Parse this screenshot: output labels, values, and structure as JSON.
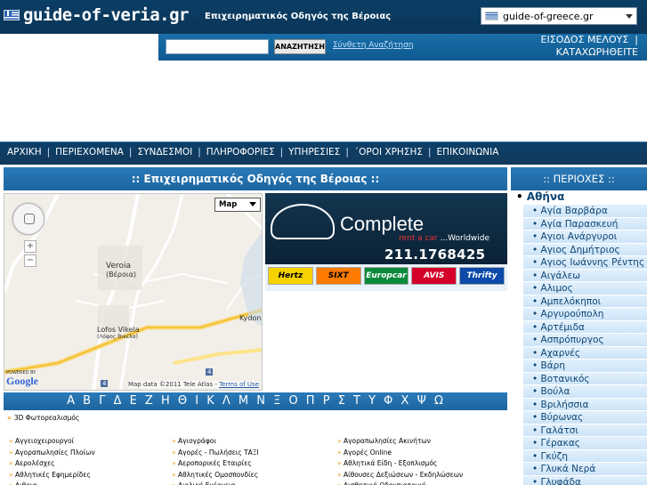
{
  "header": {
    "logo_text": "guide-of-veria.gr",
    "tagline": "Επιχειρηματικός Οδηγός της Βέροιας",
    "site_select": "guide-of-greece.gr"
  },
  "search": {
    "button_label": "ΑΝΑΖΗΤΗΣΗ",
    "advanced_link": "Σύνθετη Αναζήτηση",
    "login": "ΕΙΣΟΔΟΣ ΜΕΛΟΥΣ",
    "login_sep": "|",
    "register": "ΚΑΤΑΧΩΡΗΘΕΙΤΕ"
  },
  "nav": {
    "items": [
      "ΑΡΧΙΚΗ",
      "ΠΕΡΙΕΧΟΜΕΝΑ",
      "ΣΥΝΔΕΣΜΟΙ",
      "ΠΛΗΡΟΦΟΡΙΕΣ",
      "ΥΠΗΡΕΣΙΕΣ",
      "΄ΟΡΟΙ ΧΡΗΣΗΣ",
      "ΕΠΙΚΟΙΝΩΝΙΑ"
    ],
    "separator": "|"
  },
  "main": {
    "heading": ":: Επιχειρηματικός Οδηγός της Βέροιας ::"
  },
  "map": {
    "type_label": "Map",
    "zoom_in": "+",
    "zoom_out": "−",
    "label_veroia": "Veroia",
    "label_veroia_gr": "(Βέροια)",
    "label_lofos": "Lofos Vikela",
    "label_lofos_gr": "(Λόφος Βικέλα)",
    "label_kydon": "Kydon",
    "google_logo": "Google",
    "powered_by": "POWERED BY",
    "copyright": "Map data ©2011 Tele Atlas - ",
    "terms": "Terms of Use",
    "road_4": "4",
    "road_4b": "4"
  },
  "ad": {
    "brand": "Complete",
    "sub_red": "rent a car",
    "sub_white": "...Worldwide",
    "phone": "211.1768425",
    "logos": [
      "Hertz",
      "SIXT",
      "Europcar",
      "AVIS",
      "Thrifty"
    ]
  },
  "alphabet": "Α Β Γ Δ Ε Ζ Η Θ Ι Κ Λ Μ Ν Ξ Ο Π Ρ Σ Τ Υ Φ Χ Ψ Ω",
  "categories": {
    "first": "3D Φωτορεαλισμός",
    "col1": [
      "Αγγειοχειρουργοί",
      "Αγοραπωλησίες Πλοίων",
      "Αερολέσχες",
      "Αθλητικές Εφημερίδες",
      "Αιθρια"
    ],
    "col2": [
      "Αγιογράφοι",
      "Αγορές - Πωλήσεις ΤΑΞΙ",
      "Αεροπορικές Εταιρίες",
      "Αθλητικές Ομοσπονδίες",
      "Αιολική Ενέργεια"
    ],
    "col3": [
      "Αγοραπωλησίες Ακινήτων",
      "Αγορές Online",
      "Αθλητικά Είδη - Εξοπλισμός",
      "Αίθουσες Δεξιώσεων - Εκδηλώσεων",
      "Αισθητική Οδοντιατρική"
    ]
  },
  "sidebar": {
    "heading": ":: ΠΕΡΙΟΧΕΣ ::",
    "parent": "Αθήνα",
    "items": [
      "Αγία Βαρβάρα",
      "Αγία Παρασκευή",
      "Αγιοι Ανάργυροι",
      "Αγιος Δημήτριος",
      "Αγιος Ιωάννης Ρέντης",
      "Αιγάλεω",
      "Αλιμος",
      "Αμπελόκηποι",
      "Αργυρούπολη",
      "Αρτέμιδα",
      "Ασπρόπυργος",
      "Αχαρνές",
      "Βάρη",
      "Βοτανικός",
      "Βούλα",
      "Βριλήσσια",
      "Βύρωνας",
      "Γαλάτσι",
      "Γέρακας",
      "Γκύζη",
      "Γλυκά Νερά",
      "Γλυφάδα"
    ]
  }
}
